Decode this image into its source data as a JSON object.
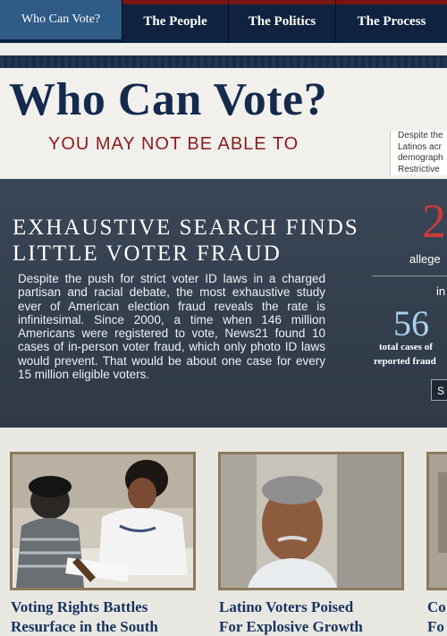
{
  "nav": {
    "items": [
      {
        "label": "Who Can Vote?"
      },
      {
        "label": "The People"
      },
      {
        "label": "The Politics"
      },
      {
        "label": "The Process"
      }
    ]
  },
  "header": {
    "title": "Who Can Vote?",
    "subtitle": "YOU MAY NOT BE ABLE TO",
    "side_blurb_lines": [
      "Despite the",
      "Latinos acr",
      "demograph",
      "Restrictive"
    ]
  },
  "feature": {
    "headline_line1": "EXHAUSTIVE SEARCH FINDS",
    "headline_line2": "LITTLE VOTER FRAUD",
    "body": "Despite the push for strict voter ID laws in a charged partisan and racial debate, the most exhaustive study ever of American election fraud reveals the rate is infinitesimal. Since 2000, a time when 146 million Americans were registered to vote, News21 found 10 cases of in-person voter fraud, which only photo ID laws would prevent. That would be about one case for every 15 million eligible voters."
  },
  "stats": {
    "big_number": "2",
    "alleged_label": "allege",
    "in_label": "in",
    "cases_number": "56",
    "cases_label1": "total cases of",
    "cases_label2": "reported fraud",
    "button_label": "S"
  },
  "cards": [
    {
      "caption_line1": "Voting Rights Battles",
      "caption_line2": "Resurface in the South"
    },
    {
      "caption_line1": "Latino Voters Poised",
      "caption_line2": "For Explosive Growth"
    },
    {
      "caption_line1": "Co",
      "caption_line2": "Fo"
    }
  ],
  "colors": {
    "nav_bg": "#0f2240",
    "nav_active": "#2f5b87",
    "title": "#152a4c",
    "subtitle": "#8d1c1c",
    "feature_bg": "#333d4b",
    "stat_red": "#c93c3c",
    "stat_blue": "#a8d2ea",
    "caption": "#17345f"
  }
}
